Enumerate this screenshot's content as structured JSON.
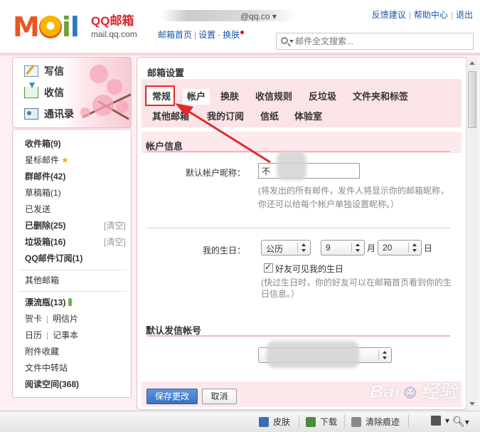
{
  "header": {
    "logo_text": "MOIL",
    "brand": "QQ邮箱",
    "brand_url": "mail.qq.com",
    "account": "@qq.co",
    "nav": {
      "home": "邮箱首页",
      "settings": "设置",
      "skin": "换肤",
      "sep": "|",
      "dash": "-"
    },
    "top_links": [
      "反馈建议",
      "帮助中心",
      "退出"
    ],
    "search_placeholder": "邮件全文搜索..."
  },
  "sidebar": {
    "actions": [
      "写信",
      "收信",
      "通讯录"
    ],
    "folders": [
      "收件箱(9)",
      "星标邮件",
      "群邮件(42)",
      "草稿箱(1)",
      "已发送",
      "已删除(25)",
      "垃圾箱(16)",
      "QQ邮件订阅(1)"
    ],
    "clear_label": "[清空]",
    "other": "其他邮箱",
    "extras": {
      "bottle": "漂流瓶(13)",
      "card": "贺卡",
      "postcard": "明信片",
      "calendar": "日历",
      "notebook": "记事本",
      "attachments": "附件收藏",
      "transfer": "文件中转站",
      "reading": "阅读空间(368)"
    }
  },
  "main": {
    "title": "邮箱设置",
    "tabs_row1": [
      "常规",
      "帐户",
      "换肤",
      "收信规则",
      "反垃圾",
      "文件夹和标签"
    ],
    "tabs_row2": [
      "其他邮箱",
      "我的订阅",
      "信纸",
      "体验室"
    ],
    "account_info": {
      "title": "帐户信息",
      "nickname_label": "默认帐户昵称：",
      "nickname_value": "不",
      "hint_line1": "(将发出的所有邮件，发件人将显示你的邮箱昵称，",
      "hint_line2": "你还可以给每个帐户单独设置昵称。）"
    },
    "birthday": {
      "label": "我的生日：",
      "calendar": "公历",
      "month": "9",
      "month_unit": "月",
      "day": "20",
      "day_unit": "日",
      "checkbox_label": "好友可见我的生日",
      "hint_line1": "(快过生日时，你的好友可以在邮箱首页看到你的生",
      "hint_line2": "日信息。）"
    },
    "default_sender": {
      "title": "默认发信帐号"
    },
    "buttons": {
      "save": "保存更改",
      "cancel": "取消"
    }
  },
  "statusbar": {
    "items": [
      "皮肤",
      "下载",
      "清除痕迹"
    ],
    "zoom_icon": "search-icon"
  },
  "watermark": "Bai 经验",
  "colors": {
    "accent": "#3b72c0",
    "pink": "#fbe4e8",
    "highlight": "#e02b2b"
  }
}
